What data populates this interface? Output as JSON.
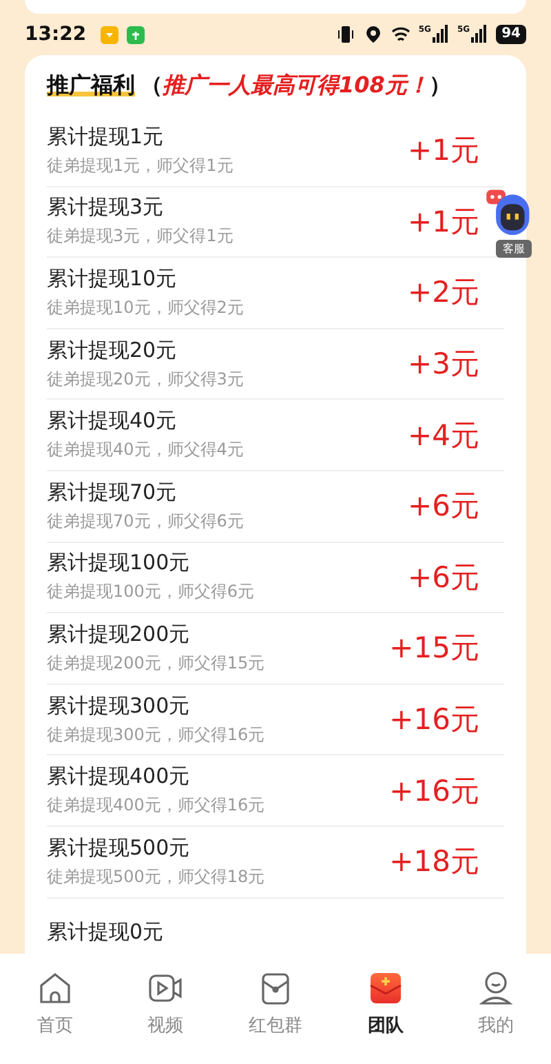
{
  "status_bar": {
    "time": "13:22",
    "network_labels": [
      "5G",
      "5G"
    ],
    "battery": "94"
  },
  "card": {
    "title": "推广福利",
    "subtitle": "（*推广一人最高可得108元！*）",
    "rows": [
      {
        "title": "累计提现1元",
        "detail": "徒弟提现1元，师父得1元",
        "reward": "+1元"
      },
      {
        "title": "累计提现3元",
        "detail": "徒弟提现3元，师父得1元",
        "reward": "+1元"
      },
      {
        "title": "累计提现10元",
        "detail": "徒弟提现10元，师父得2元",
        "reward": "+2元"
      },
      {
        "title": "累计提现20元",
        "detail": "徒弟提现20元，师父得3元",
        "reward": "+3元"
      },
      {
        "title": "累计提现40元",
        "detail": "徒弟提现40元，师父得4元",
        "reward": "+4元"
      },
      {
        "title": "累计提现70元",
        "detail": "徒弟提现70元，师父得6元",
        "reward": "+6元"
      },
      {
        "title": "累计提现100元",
        "detail": "徒弟提现100元，师父得6元",
        "reward": "+6元"
      },
      {
        "title": "累计提现200元",
        "detail": "徒弟提现200元，师父得15元",
        "reward": "+15元"
      },
      {
        "title": "累计提现300元",
        "detail": "徒弟提现300元，师父得16元",
        "reward": "+16元"
      },
      {
        "title": "累计提现400元",
        "detail": "徒弟提现400元，师父得16元",
        "reward": "+16元"
      },
      {
        "title": "累计提现500元",
        "detail": "徒弟提现500元，师父得18元",
        "reward": "+18元"
      },
      {
        "title": "累计提现0元"
      }
    ]
  },
  "support_widget": {
    "label": "客服"
  },
  "tab_bar": [
    {
      "kind": "home",
      "label": "首页",
      "selected": false
    },
    {
      "kind": "video",
      "label": "视频",
      "selected": false
    },
    {
      "kind": "bag",
      "label": "红包群",
      "selected": false
    },
    {
      "kind": "team",
      "label": "团队",
      "selected": true
    },
    {
      "kind": "person",
      "label": "我的",
      "selected": false
    }
  ]
}
